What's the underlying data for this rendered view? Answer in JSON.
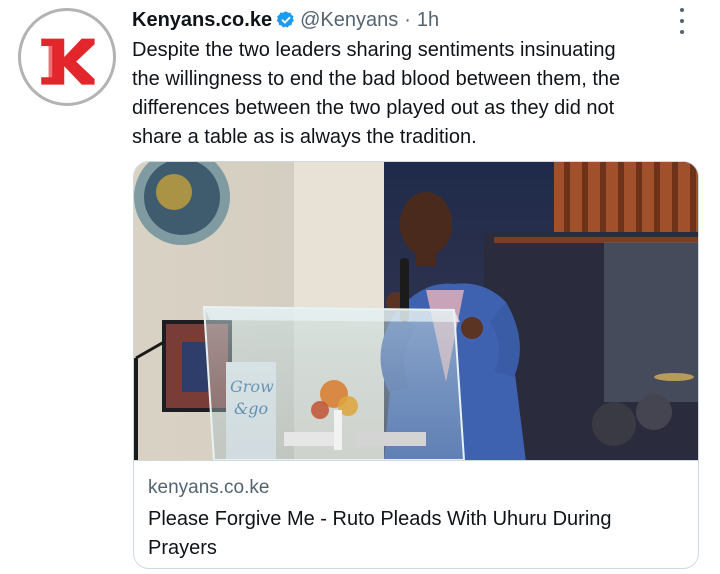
{
  "tweet": {
    "author_name": "Kenyans.co.ke",
    "verified_icon": "verified-badge-icon",
    "handle": "@Kenyans",
    "separator": "·",
    "time": "1h",
    "text_lines": [
      "Despite the two leaders sharing sentiments insinuating",
      "the willingness to end the bad blood between them, the",
      "differences between the two played out as they did not",
      "share a table as is always the tradition."
    ],
    "more_icon": "more-options-icon"
  },
  "avatar": {
    "icon": "kenyans-logo-icon",
    "brand_color": "#e2262b"
  },
  "card": {
    "image_icon": "article-photo",
    "domain": "kenyans.co.ke",
    "title_lines": [
      "Please Forgive Me - Ruto Pleads With Uhuru During",
      "Prayers"
    ],
    "banner_text": "Grow & go"
  },
  "colors": {
    "text": "#0f1419",
    "secondary": "#536471",
    "verified": "#1d9bf0",
    "border": "#cfd9de"
  }
}
